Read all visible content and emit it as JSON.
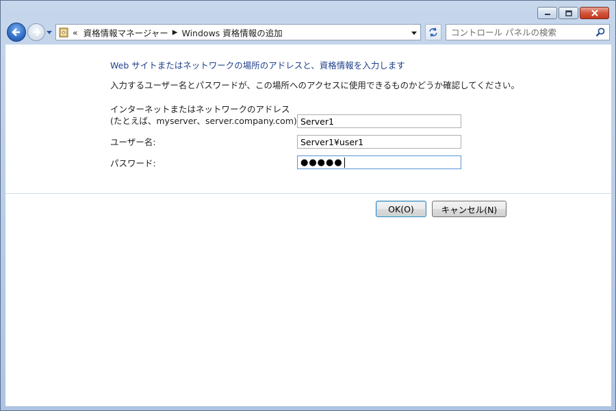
{
  "address_bar": {
    "overflow": "«",
    "crumbs": [
      "資格情報マネージャー",
      "Windows 資格情報の追加"
    ]
  },
  "search": {
    "placeholder": "コントロール パネルの検索"
  },
  "form": {
    "heading": "Web サイトまたはネットワークの場所のアドレスと、資格情報を入力します",
    "description": "入力するユーザー名とパスワードが、この場所へのアクセスに使用できるものかどうか確認してください。",
    "address_label_line1": "インターネットまたはネットワークのアドレス",
    "address_label_line2": "(たとえば、myserver、server.company.com):",
    "address_value": "Server1",
    "username_label": "ユーザー名:",
    "username_value": "Server1¥user1",
    "password_label": "パスワード:",
    "password_mask": "●●●●●"
  },
  "buttons": {
    "ok": "OK(O)",
    "cancel": "キャンセル(N)"
  },
  "icons": [
    "minimize-icon",
    "maximize-icon",
    "close-icon",
    "back-arrow-icon",
    "forward-arrow-icon",
    "control-panel-icon",
    "refresh-icon",
    "search-icon"
  ]
}
